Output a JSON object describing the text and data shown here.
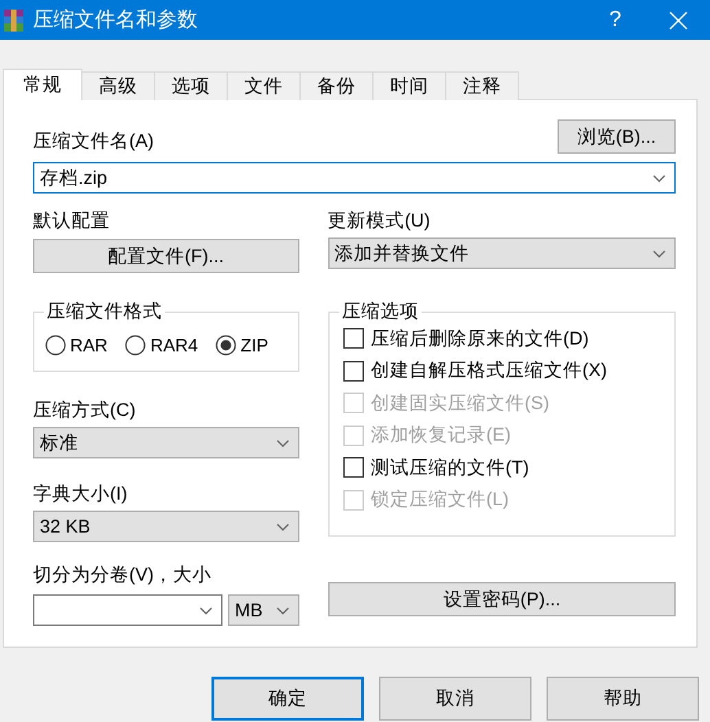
{
  "window": {
    "title": "压缩文件名和参数",
    "help": "?"
  },
  "tabs": [
    {
      "label": "常规",
      "selected": true
    },
    {
      "label": "高级",
      "selected": false
    },
    {
      "label": "选项",
      "selected": false
    },
    {
      "label": "文件",
      "selected": false
    },
    {
      "label": "备份",
      "selected": false
    },
    {
      "label": "时间",
      "selected": false
    },
    {
      "label": "注释",
      "selected": false
    }
  ],
  "archive_name": {
    "label": "压缩文件名(A)",
    "value": "存档.zip",
    "browse_button": "浏览(B)..."
  },
  "default_profile": {
    "label": "默认配置",
    "button": "配置文件(F)..."
  },
  "update_mode": {
    "label": "更新模式(U)",
    "value": "添加并替换文件"
  },
  "archive_format": {
    "legend": "压缩文件格式",
    "options": [
      {
        "label": "RAR",
        "selected": false
      },
      {
        "label": "RAR4",
        "selected": false
      },
      {
        "label": "ZIP",
        "selected": true
      }
    ]
  },
  "compression_method": {
    "label": "压缩方式(C)",
    "value": "标准"
  },
  "dictionary_size": {
    "label": "字典大小(I)",
    "value": "32 KB"
  },
  "split_volumes": {
    "label": "切分为分卷(V)，大小",
    "unit": "MB"
  },
  "compression_options": {
    "legend": "压缩选项",
    "items": [
      {
        "label": "压缩后删除原来的文件(D)",
        "checked": false,
        "disabled": false
      },
      {
        "label": "创建自解压格式压缩文件(X)",
        "checked": false,
        "disabled": false
      },
      {
        "label": "创建固实压缩文件(S)",
        "checked": false,
        "disabled": true
      },
      {
        "label": "添加恢复记录(E)",
        "checked": false,
        "disabled": true
      },
      {
        "label": "测试压缩的文件(T)",
        "checked": false,
        "disabled": false
      },
      {
        "label": "锁定压缩文件(L)",
        "checked": false,
        "disabled": true
      }
    ]
  },
  "password_button": "设置密码(P)...",
  "buttons": [
    {
      "label": "确定",
      "default": true
    },
    {
      "label": "取消",
      "default": false
    },
    {
      "label": "帮助",
      "default": false
    }
  ]
}
